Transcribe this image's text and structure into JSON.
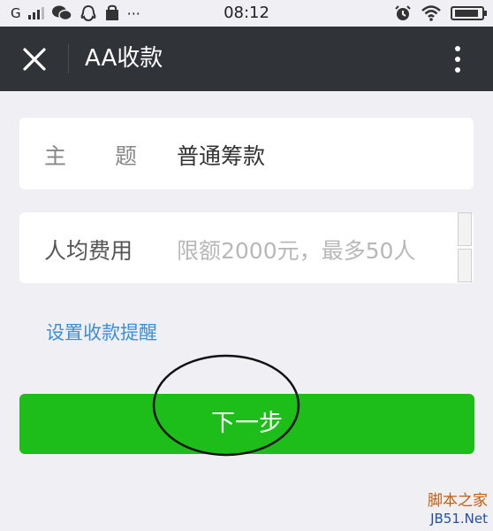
{
  "status_bar": {
    "network": "G",
    "time": "08:12",
    "more_dots": "···"
  },
  "title_bar": {
    "title": "AA收款"
  },
  "form": {
    "subject": {
      "label_1": "主",
      "label_2": "题",
      "value": "普通筹款"
    },
    "amount": {
      "label": "人均费用",
      "placeholder": "限额2000元，最多50人"
    }
  },
  "reminder_link": "设置收款提醒",
  "next_button": "下一步",
  "watermark": {
    "line1": "脚本之家",
    "line2": "JB51.Net"
  },
  "colors": {
    "title_bar_bg": "#303337",
    "button_green": "#1dbd1a",
    "link_blue": "#3a8fd6",
    "page_bg": "#efeff4"
  }
}
